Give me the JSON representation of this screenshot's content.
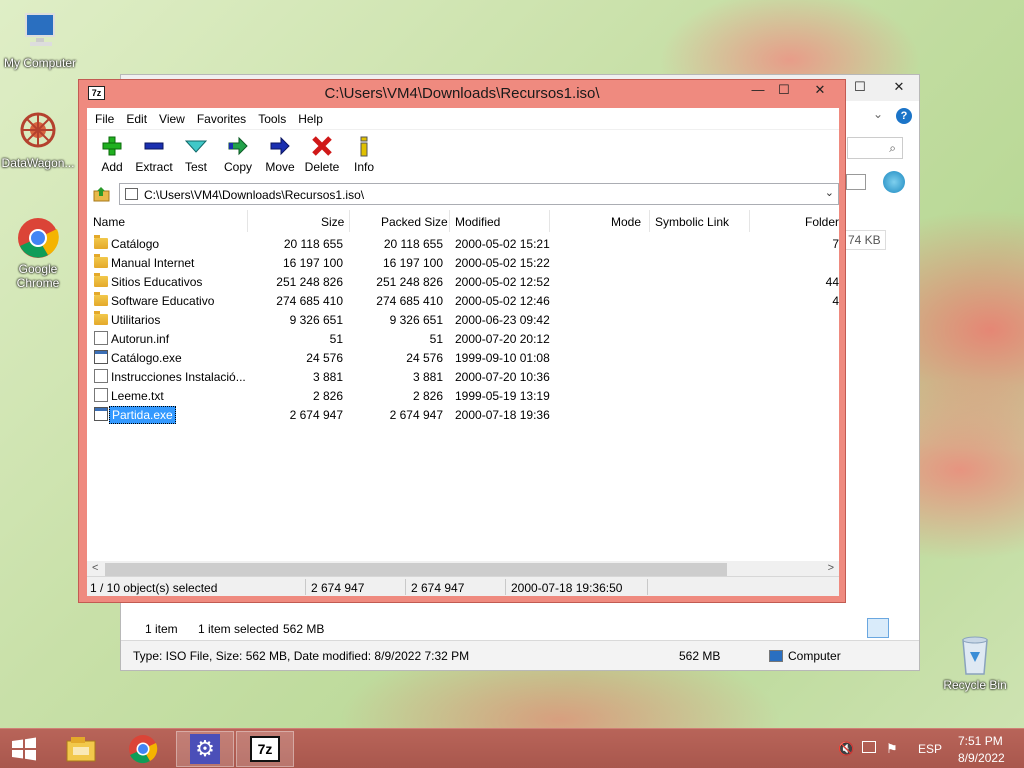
{
  "desktop": {
    "icons": [
      {
        "label": "My Computer"
      },
      {
        "label": "DataWagon..."
      },
      {
        "label": "Google Chrome"
      },
      {
        "label": "Recycle Bin"
      }
    ]
  },
  "explorer": {
    "ghost_size": "74 KB",
    "status_items": "1 item",
    "status_selected": "1 item selected",
    "status_selected_size": "562 MB",
    "details": "Type: ISO File, Size: 562 MB, Date modified: 8/9/2022 7:32 PM",
    "details_size": "562 MB",
    "details_location": "Computer"
  },
  "zip": {
    "title": "C:\\Users\\VM4\\Downloads\\Recursos1.iso\\",
    "app_icon": "7z",
    "menu": [
      "File",
      "Edit",
      "View",
      "Favorites",
      "Tools",
      "Help"
    ],
    "toolbar": [
      {
        "label": "Add",
        "icon": "plus-icon"
      },
      {
        "label": "Extract",
        "icon": "minus-icon"
      },
      {
        "label": "Test",
        "icon": "check-icon"
      },
      {
        "label": "Copy",
        "icon": "copy-arrow-icon"
      },
      {
        "label": "Move",
        "icon": "move-arrow-icon"
      },
      {
        "label": "Delete",
        "icon": "x-icon"
      },
      {
        "label": "Info",
        "icon": "info-icon"
      }
    ],
    "address": "C:\\Users\\VM4\\Downloads\\Recursos1.iso\\",
    "columns": [
      "Name",
      "Size",
      "Packed Size",
      "Modified",
      "Mode",
      "Symbolic Link",
      "Folder"
    ],
    "rows": [
      {
        "type": "folder",
        "name": "Catálogo",
        "size": "20 118 655",
        "packed": "20 118 655",
        "modified": "2000-05-02 15:21",
        "folders": "7"
      },
      {
        "type": "folder",
        "name": "Manual Internet",
        "size": "16 197 100",
        "packed": "16 197 100",
        "modified": "2000-05-02 15:22",
        "folders": ""
      },
      {
        "type": "folder",
        "name": "Sitios Educativos",
        "size": "251 248 826",
        "packed": "251 248 826",
        "modified": "2000-05-02 12:52",
        "folders": "44"
      },
      {
        "type": "folder",
        "name": "Software Educativo",
        "size": "274 685 410",
        "packed": "274 685 410",
        "modified": "2000-05-02 12:46",
        "folders": "4"
      },
      {
        "type": "folder",
        "name": "Utilitarios",
        "size": "9 326 651",
        "packed": "9 326 651",
        "modified": "2000-06-23 09:42",
        "folders": ""
      },
      {
        "type": "file",
        "name": "Autorun.inf",
        "size": "51",
        "packed": "51",
        "modified": "2000-07-20 20:12",
        "folders": ""
      },
      {
        "type": "exe",
        "name": "Catálogo.exe",
        "size": "24 576",
        "packed": "24 576",
        "modified": "1999-09-10 01:08",
        "folders": ""
      },
      {
        "type": "file",
        "name": "Instrucciones Instalació...",
        "size": "3 881",
        "packed": "3 881",
        "modified": "2000-07-20 10:36",
        "folders": ""
      },
      {
        "type": "file",
        "name": "Leeme.txt",
        "size": "2 826",
        "packed": "2 826",
        "modified": "1999-05-19 13:19",
        "folders": ""
      },
      {
        "type": "exe",
        "name": "Partida.exe",
        "size": "2 674 947",
        "packed": "2 674 947",
        "modified": "2000-07-18 19:36",
        "folders": "",
        "selected": true
      }
    ],
    "status": {
      "selection": "1 / 10 object(s) selected",
      "size": "2 674 947",
      "packed": "2 674 947",
      "modified": "2000-07-18 19:36:50"
    }
  },
  "taskbar": {
    "language": "ESP",
    "time": "7:51 PM",
    "date": "8/9/2022",
    "apps": [
      "file-explorer-icon",
      "chrome-icon",
      "settings-gear-icon",
      "7zip-icon"
    ]
  },
  "colors": {
    "titlebar": "#ef8a7f",
    "selection": "#3399ff",
    "taskbar": "#b15e53"
  }
}
